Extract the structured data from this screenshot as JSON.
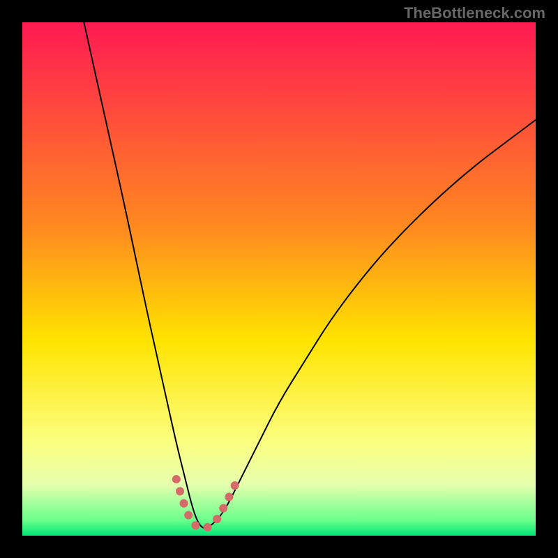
{
  "watermark": "TheBottleneck.com",
  "chart_data": {
    "type": "line",
    "title": "",
    "xlabel": "",
    "ylabel": "",
    "xlim": [
      0,
      100
    ],
    "ylim": [
      0,
      100
    ],
    "background_gradient": {
      "stops": [
        {
          "offset": 0.0,
          "color": "#ff1a52"
        },
        {
          "offset": 0.4,
          "color": "#ff8a1f"
        },
        {
          "offset": 0.62,
          "color": "#ffe400"
        },
        {
          "offset": 0.82,
          "color": "#fbff82"
        },
        {
          "offset": 0.9,
          "color": "#e6ffad"
        },
        {
          "offset": 0.97,
          "color": "#6aff8c"
        },
        {
          "offset": 1.0,
          "color": "#00e676"
        }
      ]
    },
    "series": [
      {
        "name": "bottleneck-curve",
        "color": "#000000",
        "width": 2,
        "x": [
          12,
          16,
          20,
          24,
          26,
          28,
          30,
          32,
          33,
          34,
          35,
          36,
          38,
          40,
          42,
          46,
          50,
          55,
          60,
          66,
          72,
          80,
          88,
          96,
          100
        ],
        "y": [
          100,
          82,
          64,
          45,
          36,
          27,
          18,
          10,
          6,
          3,
          1.5,
          1.5,
          3,
          6,
          10,
          18,
          26,
          34,
          42,
          50,
          57,
          65,
          72,
          78,
          81
        ]
      },
      {
        "name": "valley-marker",
        "color": "#d66a6a",
        "width": 12,
        "dash": [
          0.1,
          18
        ],
        "linecap": "round",
        "x": [
          30,
          31.5,
          33,
          34.5,
          36,
          37.5,
          39,
          40.5,
          42
        ],
        "y": [
          11,
          6,
          2.5,
          1.5,
          1.5,
          2.5,
          5,
          8,
          11
        ]
      }
    ]
  }
}
